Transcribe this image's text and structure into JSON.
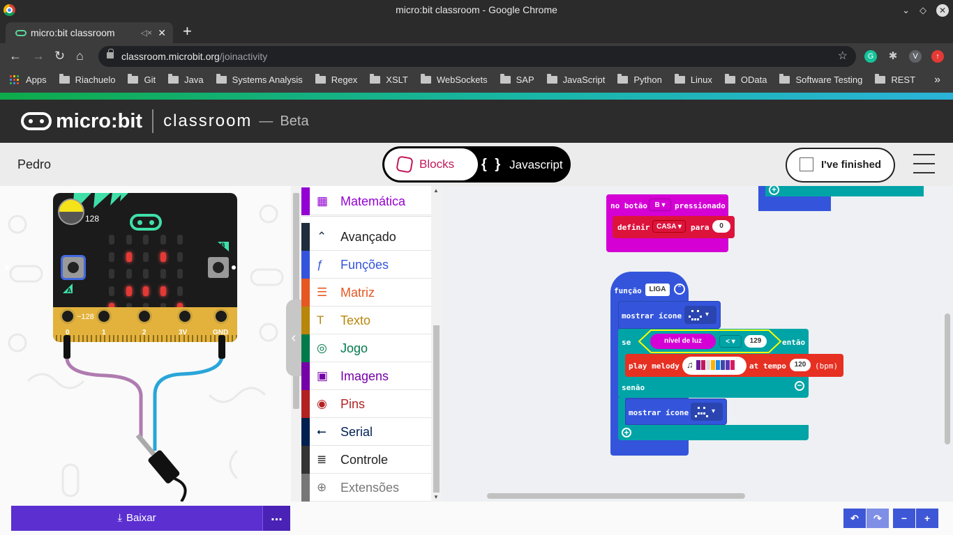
{
  "browser": {
    "window_title": "micro:bit classroom - Google Chrome",
    "tab_title": "micro:bit classroom",
    "url_host": "classroom.microbit.org",
    "url_path": "/joinactivity",
    "profile_initial": "V",
    "bookmarks": [
      "Apps",
      "Riachuelo",
      "Git",
      "Java",
      "Systems Analysis",
      "Regex",
      "XSLT",
      "WebSockets",
      "SAP",
      "JavaScript",
      "Python",
      "Linux",
      "OData",
      "Software Testing",
      "REST"
    ]
  },
  "header": {
    "brand": "micro:bit",
    "section": "classroom",
    "dash": "—",
    "badge": "Beta"
  },
  "subbar": {
    "user": "Pedro",
    "mode_blocks": "Blocks",
    "mode_js_braces": "{ }",
    "mode_js": "Javascript",
    "finished": "I've finished"
  },
  "simulator": {
    "light_level": "128",
    "pin0_value": "~128",
    "button_a": "A",
    "button_b": "B",
    "pins": [
      "0",
      "1",
      "2",
      "3V",
      "GND"
    ]
  },
  "toolbox": {
    "categories": [
      {
        "label": "Matemática",
        "color": "#9400d3",
        "icon": "calculator-icon"
      },
      {
        "label": "Avançado",
        "color": "#1f2d3d",
        "icon": "chevron-up-icon"
      },
      {
        "label": "Funções",
        "color": "#3455db",
        "icon": "function-icon"
      },
      {
        "label": "Matriz",
        "color": "#e65722",
        "icon": "list-icon"
      },
      {
        "label": "Texto",
        "color": "#b8860b",
        "icon": "text-icon"
      },
      {
        "label": "Jogo",
        "color": "#007a4b",
        "icon": "gamepad-icon"
      },
      {
        "label": "Imagens",
        "color": "#7600a8",
        "icon": "image-icon"
      },
      {
        "label": "Pins",
        "color": "#b22222",
        "icon": "target-icon"
      },
      {
        "label": "Serial",
        "color": "#002050",
        "icon": "usb-icon"
      },
      {
        "label": "Controle",
        "color": "#333333",
        "icon": "server-icon"
      },
      {
        "label": "Extensões",
        "color": "#777777",
        "icon": "plus-circle-icon"
      }
    ]
  },
  "workspace": {
    "button_block": {
      "label": "no botão",
      "button": "B",
      "suffix": "pressionado"
    },
    "set_block": {
      "label": "definir",
      "variable": "CASA",
      "mid": "para",
      "value": "0"
    },
    "function_block": {
      "label": "função",
      "name": "LIGA"
    },
    "show_icon_1": {
      "label": "mostrar ícone"
    },
    "if_block": {
      "label": "se",
      "sensor": "nível de luz",
      "operator": "<",
      "value": "129",
      "then": "então"
    },
    "melody_block": {
      "label": "play melody",
      "mid": "at tempo",
      "tempo": "120",
      "unit": "(bpm)"
    },
    "else_label": "senão",
    "show_icon_2": {
      "label": "mostrar ícone"
    }
  },
  "bottom": {
    "download": "Baixar",
    "more": "...",
    "undo": "↶",
    "redo": "↷",
    "zoom_out": "−",
    "zoom_in": "+"
  },
  "colors": {
    "header_bg": "#2c2c2c",
    "download": "#5c2fd1",
    "variables_block": "#dc143c",
    "input_block": "#d400d4",
    "function_block": "#3455db",
    "logic_block": "#00a4a6",
    "music_block": "#e63022"
  }
}
